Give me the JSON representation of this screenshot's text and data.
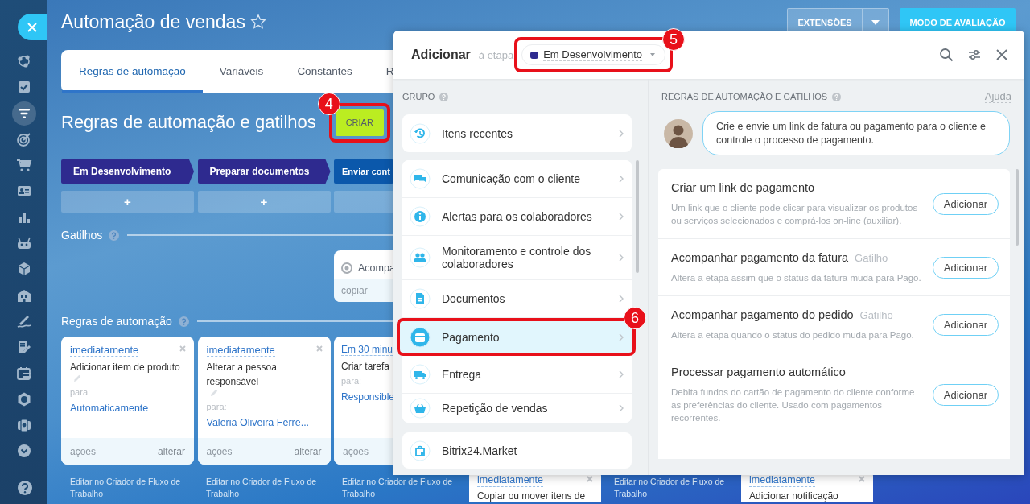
{
  "sidebar": {
    "items": [
      {
        "selected": false
      },
      {
        "selected": false
      },
      {
        "selected": true
      },
      {
        "selected": false
      },
      {
        "selected": false
      },
      {
        "selected": false
      },
      {
        "selected": false
      },
      {
        "selected": false
      },
      {
        "selected": false
      },
      {
        "selected": false
      },
      {
        "selected": false
      },
      {
        "selected": false
      },
      {
        "selected": false
      },
      {
        "selected": false
      },
      {
        "selected": false
      },
      {
        "selected": false
      }
    ]
  },
  "header": {
    "title": "Automação de vendas",
    "favorite": false,
    "buttons": [
      {
        "label": "EXTENSÕES",
        "kind": "split"
      },
      {
        "label": "MODO DE AVALIAÇÃO",
        "kind": "primary"
      }
    ]
  },
  "tabs": [
    {
      "label": "Regras de automação",
      "selected": true
    },
    {
      "label": "Variáveis",
      "selected": false
    },
    {
      "label": "Constantes",
      "selected": false
    },
    {
      "label": "R",
      "selected": false
    }
  ],
  "section": {
    "title": "Regras de automação e gatilhos",
    "create_button": {
      "label": "CRIAR",
      "callout": "4"
    }
  },
  "triggers_title": "Gatilhos",
  "rules_title": "Regras de automação",
  "columns": [
    {
      "stage": {
        "label": "Em Desenvolvimento",
        "color": "#2e2a8f"
      },
      "add": "+",
      "rule": {
        "timing": "imediatamente",
        "title": "Adicionar item de produto",
        "target_label": "para:",
        "target": "Automaticamente",
        "actions": "ações",
        "change": "alterar"
      },
      "bottom": {
        "kind": "link",
        "text": "Editar no Criador de Fluxo de Trabalho"
      }
    },
    {
      "stage": {
        "label": "Preparar documentos",
        "color": "#2e2a8f"
      },
      "add": "+",
      "rule": {
        "timing": "imediatamente",
        "title": "Alterar a pessoa responsável",
        "target_label": "para:",
        "target": "Valeria Oliveira Ferre...",
        "actions": "ações",
        "change": "alterar"
      },
      "bottom": {
        "kind": "link",
        "text": "Editar no Criador de Fluxo de Trabalho"
      }
    },
    {
      "stage": {
        "label": "Enviar cont",
        "color": "#0b58ab"
      },
      "trigger": {
        "title": "Acompa",
        "action": "copiar"
      },
      "rule": {
        "timing": "Em 30 minu",
        "title": "Criar tarefa",
        "target_label": "para:",
        "target": "Responsible",
        "actions": "ações"
      },
      "bottom": {
        "kind": "link",
        "text": "Editar no Criador de Fluxo de Trabalho"
      }
    },
    {
      "bottom": {
        "kind": "card",
        "timing": "imediatamente",
        "title": "Copiar ou mover itens de"
      }
    },
    {
      "bottom": {
        "kind": "link",
        "text": "Editar no Criador de Fluxo de Trabalho"
      }
    },
    {
      "bottom": {
        "kind": "card",
        "timing": "imediatamente",
        "title": "Adicionar notificação"
      }
    }
  ],
  "dialog": {
    "title": "Adicionar",
    "stage_prefix": "à etapa",
    "stage": {
      "label": "Em Desenvolvimento",
      "color": "#2e2a8f",
      "callout": "5"
    },
    "group_title": "GRUPO",
    "recent": {
      "label": "Itens recentes"
    },
    "groups": [
      {
        "label": "Comunicação com o cliente",
        "selected": false
      },
      {
        "label": "Alertas para os colaboradores",
        "selected": false
      },
      {
        "label": "Monitoramento e controle dos colaboradores",
        "selected": false
      },
      {
        "label": "Documentos",
        "selected": false
      },
      {
        "label": "Pagamento",
        "selected": true,
        "callout": "6"
      },
      {
        "label": "Entrega",
        "selected": false
      },
      {
        "label": "Repetição de vendas",
        "selected": false
      }
    ],
    "market": {
      "label": "Bitrix24.Market"
    },
    "rules_title": "REGRAS DE AUTOMAÇÃO E GATILHOS",
    "help_link": "Ajuda",
    "tip": "Crie e envie um link de fatura ou pagamento para o cliente e controle o processo de pagamento.",
    "items": [
      {
        "title": "Criar um link de pagamento",
        "description": "Um link que o cliente pode clicar para visualizar os produtos ou serviços selecionados e comprá-los on-line (auxiliar).",
        "button": "Adicionar"
      },
      {
        "title": "Acompanhar pagamento da fatura",
        "tag": "Gatilho",
        "description": "Altera a etapa assim que o status da fatura muda para Pago.",
        "button": "Adicionar"
      },
      {
        "title": "Acompanhar pagamento do pedido",
        "tag": "Gatilho",
        "description": "Altera a etapa quando o status do pedido muda para Pago.",
        "button": "Adicionar"
      },
      {
        "title": "Processar pagamento automático",
        "description": "Debita fundos do cartão de pagamento do cliente conforme as preferências do cliente. Usado com pagamentos recorrentes.",
        "button": "Adicionar"
      }
    ]
  }
}
